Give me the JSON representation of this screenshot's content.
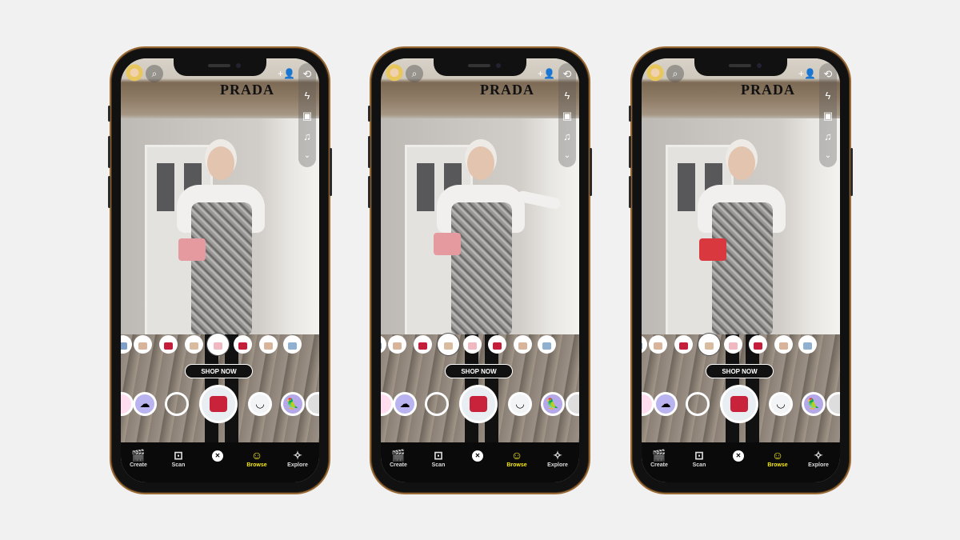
{
  "brand": "PRADA",
  "shop_now": "SHOP NOW",
  "nav": [
    {
      "label": "Create",
      "icon": "clapperboard-icon",
      "glyph": "🎬"
    },
    {
      "label": "Scan",
      "icon": "scan-icon",
      "glyph": "⊡"
    },
    {
      "label": "",
      "icon": "close-icon",
      "glyph": "✕"
    },
    {
      "label": "Browse",
      "icon": "smiley-icon",
      "glyph": "☺",
      "active": true
    },
    {
      "label": "Explore",
      "icon": "explore-icon",
      "glyph": "✧"
    }
  ],
  "colors": {
    "active_tab": "#f4e61a",
    "bag_pink": "#e59aa0",
    "bag_red": "#c8233a"
  },
  "bag_swatches": [
    "#7fa0c8",
    "#d8b59a",
    "#c41e3a",
    "#d9bca0",
    "#f0b8c0",
    "#c41e3a",
    "#d8b59a",
    "#8fb0d0"
  ],
  "phones": [
    {
      "bag_color": "#e59aa0",
      "pose": "hand-on-hip",
      "selected_swatch": 4
    },
    {
      "bag_color": "#e59aa0",
      "pose": "arm-extended",
      "selected_swatch": 3
    },
    {
      "bag_color": "#d9383f",
      "pose": "hand-on-hip",
      "selected_swatch": 3
    }
  ]
}
